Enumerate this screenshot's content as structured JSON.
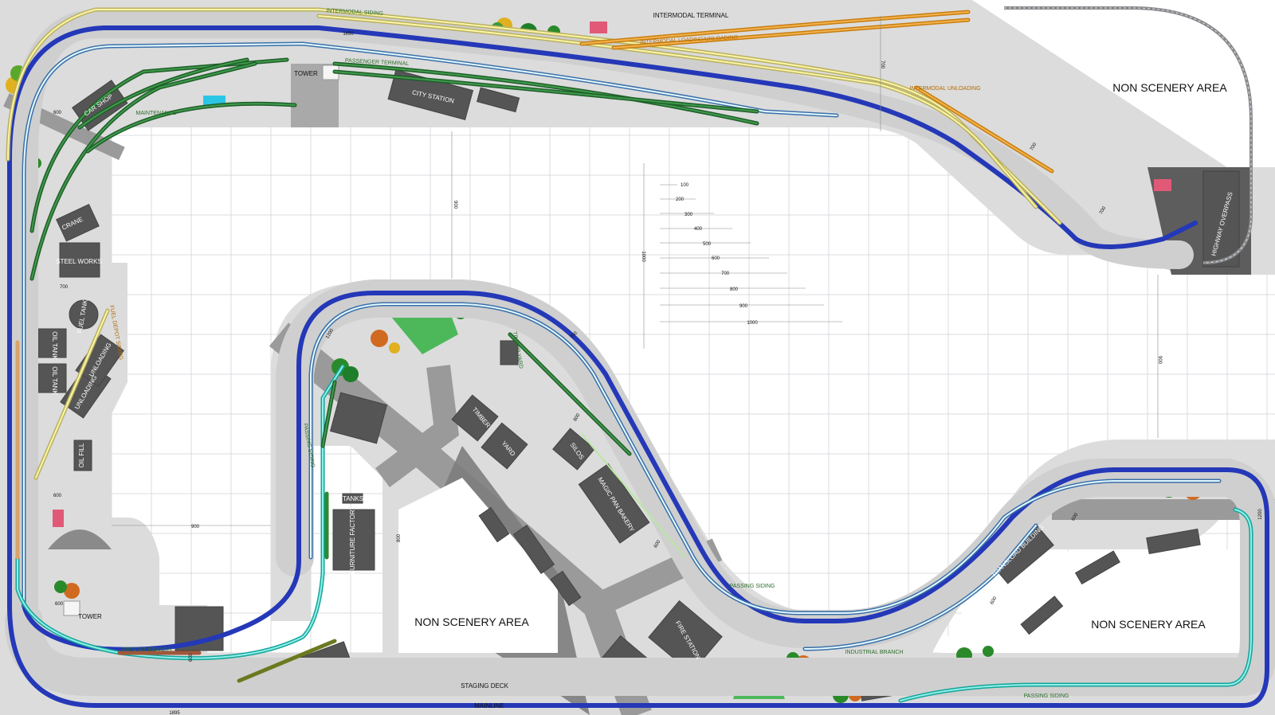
{
  "areas": {
    "top_right": "NON SCENERY AREA",
    "center_bottom": "NON SCENERY AREA",
    "bottom_right": "NON SCENERY AREA"
  },
  "buildings": {
    "intermodal_terminal": "INTERMODAL TERMINAL",
    "city_station": "CITY STATION",
    "tower_top": "TOWER",
    "car_shop": "CAR SHOP",
    "crane": "CRANE",
    "steel_works": "STEEL WORKS",
    "fuel_tank": "FUEL TANK",
    "oil_tank_1": "OIL TANK",
    "oil_tank_2": "OIL TANK",
    "unloading_1": "UNLOADING",
    "unloading_2": "UNLOADING",
    "oil_fill": "OIL FILL",
    "tower_bottom": "TOWER",
    "timber": "TIMBER",
    "yard": "YARD",
    "silos": "SILOS",
    "magic_pan_bakery": "MAGIC PAN BAKERY",
    "tanks": "TANKS",
    "furniture_factory": "FURNITURE FACTORY",
    "fire_station": "FIRE STATION",
    "transload_building": "TRANSLOAD BUILDING",
    "highway_overpass": "HIGHWAY OVERPASS",
    "staging_deck": "STAGING DECK"
  },
  "tracks": {
    "intermodal_siding": "INTERMODAL SIDING",
    "intermodal_loading": "INTERMODAL LOADING/UNLOADING",
    "passenger_terminal": "PASSENGER TERMINAL",
    "maintenance": "MAINTENANCE",
    "intermodal_unloading": "INTERMODAL UNLOADING",
    "fuel_depot_siding": "FUEL DEPOT SIDING",
    "timber_yard": "TIMBER YARD",
    "passing_siding_left": "PASSING SIDING",
    "passing_siding_mid": "PASSING SIDING",
    "passing_siding_bottom": "PASSING SIDING",
    "freight_branch": "FREIGHT BRANCH",
    "industrial_branch": "INDUSTRIAL BRANCH",
    "mainline": "MAINLINE"
  },
  "scale": {
    "ticks": [
      "100",
      "200",
      "300",
      "400",
      "500",
      "600",
      "700",
      "800",
      "900",
      "1000"
    ],
    "vertical": "1000"
  },
  "dimensions": {
    "top_len": "1650",
    "bottom_len": "1895",
    "left_900": "900",
    "mid_900": "900",
    "top_700": "700",
    "right_900": "900",
    "left_700": "700",
    "left_600a": "600",
    "left_600b": "600",
    "left_600c": "600",
    "mid_1200": "1200",
    "curve_700": "700",
    "staging_600": "600",
    "bend_800": "800",
    "bend_600": "600",
    "right_600": "600",
    "right_1200": "1200",
    "right_700a": "700",
    "right_700b": "700",
    "right_600b": "600",
    "center_800": "800"
  },
  "colors": {
    "mainline": "#2438b8",
    "light_track": "#3a6fa8",
    "cyan_track": "#16a39a",
    "yellow_track": "#b9b060",
    "green_track": "#1f5e2a",
    "orange_track": "#c87d10",
    "subroadbed": "#cfcfcf",
    "scenery_pad": "#dcdcdc",
    "building": "#555555",
    "grid": "#cfd3d8"
  }
}
